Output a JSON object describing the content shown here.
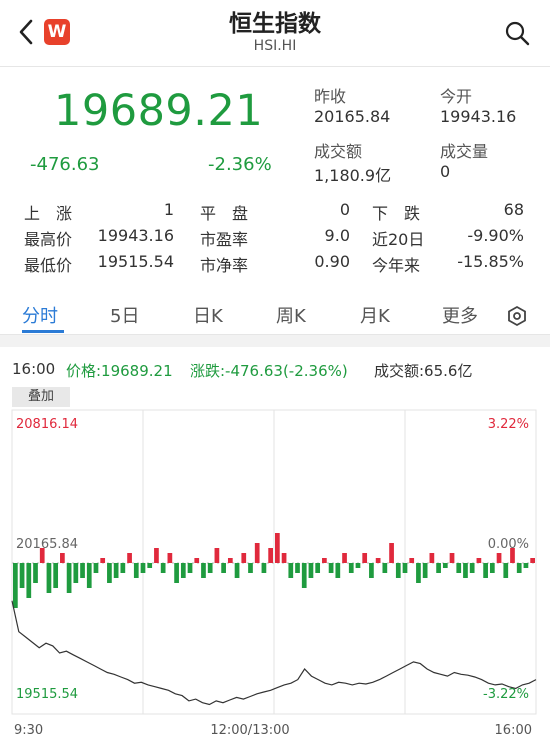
{
  "header": {
    "title": "恒生指数",
    "subtitle": "HSI.HI",
    "logo_letter": "W",
    "back_icon": "chevron-left-icon",
    "search_icon": "search-icon"
  },
  "quote": {
    "last": "19689.21",
    "change": "-476.63",
    "change_pct": "-2.36%",
    "prev_close_label": "昨收",
    "prev_close": "20165.84",
    "open_label": "今开",
    "open": "19943.16",
    "turnover_label": "成交额",
    "turnover": "1,180.9亿",
    "volume_label": "成交量",
    "volume": "0"
  },
  "stats": {
    "up_label": "上　涨",
    "up": "1",
    "flat_label": "平　盘",
    "flat": "0",
    "down_label": "下　跌",
    "down": "68",
    "high_label": "最高价",
    "high": "19943.16",
    "pe_label": "市盈率",
    "pe": "9.0",
    "d20_label": "近20日",
    "d20": "-9.90%",
    "low_label": "最低价",
    "low": "19515.54",
    "pb_label": "市净率",
    "pb": "0.90",
    "ytd_label": "今年来",
    "ytd": "-15.85%"
  },
  "tabs": [
    "分时",
    "5日",
    "日K",
    "周K",
    "月K",
    "更多"
  ],
  "settings_icon": "hexagon-settings-icon",
  "chart_info": {
    "time": "16:00",
    "price": "价格:19689.21",
    "change": "涨跌:-476.63(-2.36%)",
    "turnover": "成交额:65.6亿",
    "overlay_btn": "叠加"
  },
  "chart_data": {
    "type": "line",
    "y_top_label": "20816.14",
    "y_top_pct": "3.22%",
    "y_mid_label": "20165.84",
    "y_mid_pct": "0.00%",
    "y_bottom_label": "19515.54",
    "y_bottom_pct": "-3.22%",
    "x_labels": [
      "9:30",
      "12:00/13:00",
      "16:00"
    ],
    "ylim": [
      19515.54,
      20816.14
    ],
    "prev_close": 20165.84,
    "colors": {
      "up": "#e0293c",
      "down": "#1f9b3f",
      "line": "#333333",
      "grid": "#e3e3e3"
    },
    "price_series": [
      20165.0,
      19990.0,
      19960.0,
      19930.0,
      19900.0,
      19925.0,
      19910.0,
      19870.0,
      19880.0,
      19860.0,
      19840.0,
      19820.0,
      19800.0,
      19780.0,
      19760.0,
      19750.0,
      19735.0,
      19720.0,
      19700.0,
      19705.0,
      19690.0,
      19680.0,
      19670.0,
      19660.0,
      19640.0,
      19630.0,
      19600.0,
      19610.0,
      19590.0,
      19580.0,
      19600.0,
      19590.0,
      19605.0,
      19620.0,
      19610.0,
      19625.0,
      19640.0,
      19650.0,
      19660.0,
      19675.0,
      19690.0,
      19700.0,
      19720.0,
      19780.0,
      19740.0,
      19720.0,
      19700.0,
      19690.0,
      19705.0,
      19700.0,
      19690.0,
      19700.0,
      19695.0,
      19705.0,
      19720.0,
      19740.0,
      19760.0,
      19780.0,
      19800.0,
      19820.0,
      19810.0,
      19780.0,
      19760.0,
      19750.0,
      19740.0,
      19760.0,
      19750.0,
      19745.0,
      19735.0,
      19720.0,
      19700.0,
      19690.0,
      19695.0,
      19680.0,
      19670.0,
      19690.0,
      19700.0,
      19720.0
    ],
    "volume_series": [
      -0.9,
      -0.5,
      -0.7,
      -0.4,
      0.3,
      -0.6,
      -0.5,
      0.2,
      -0.6,
      -0.4,
      -0.3,
      -0.5,
      -0.2,
      0.1,
      -0.4,
      -0.3,
      -0.2,
      0.2,
      -0.3,
      -0.2,
      -0.1,
      0.3,
      -0.2,
      0.2,
      -0.4,
      -0.3,
      -0.2,
      0.1,
      -0.3,
      -0.2,
      0.3,
      -0.2,
      0.1,
      -0.3,
      0.2,
      -0.2,
      0.4,
      -0.2,
      0.3,
      0.6,
      0.2,
      -0.3,
      -0.2,
      -0.5,
      -0.3,
      -0.2,
      0.1,
      -0.2,
      -0.3,
      0.2,
      -0.2,
      -0.1,
      0.2,
      -0.3,
      0.1,
      -0.2,
      0.4,
      -0.3,
      -0.2,
      0.1,
      -0.4,
      -0.3,
      0.2,
      -0.2,
      -0.1,
      0.2,
      -0.2,
      -0.3,
      -0.2,
      0.1,
      -0.3,
      -0.2,
      0.2,
      -0.3,
      0.3,
      -0.2,
      -0.1,
      0.1
    ]
  }
}
